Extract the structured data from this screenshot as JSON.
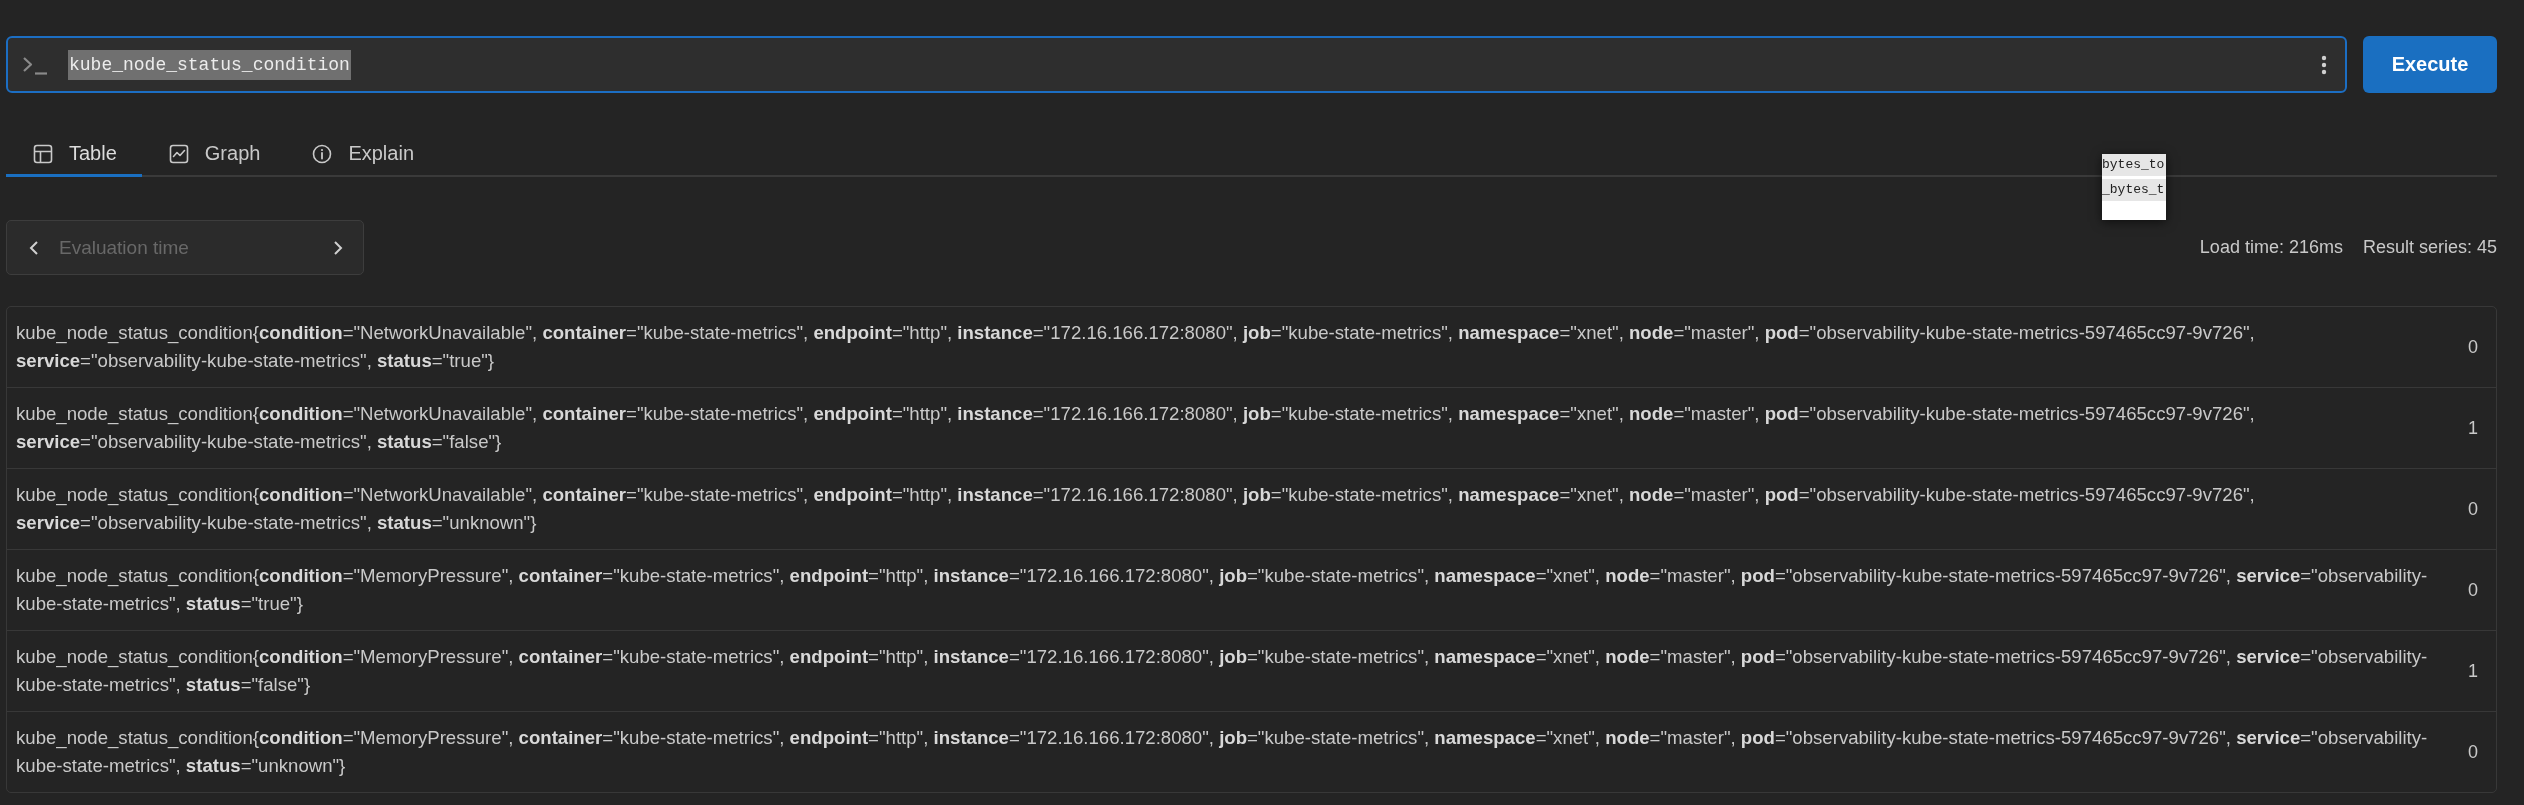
{
  "query": {
    "value": "kube_node_status_condition",
    "text_selected": true
  },
  "execute_button": {
    "label": "Execute"
  },
  "tabs": [
    {
      "label": "Table",
      "selected": true
    },
    {
      "label": "Graph",
      "selected": false
    },
    {
      "label": "Explain",
      "selected": false
    }
  ],
  "autocomplete_popup": {
    "items": [
      "bytes_to",
      "_bytes_t"
    ]
  },
  "evaluation_time": {
    "placeholder": "Evaluation time"
  },
  "stats": {
    "load_time": "Load time: 216ms",
    "result_series": "Result series: 45"
  },
  "results": [
    {
      "lines": [
        "kube_node_status_condition{**condition**=\"NetworkUnavailable\", **container**=\"kube-state-metrics\", **endpoint**=\"http\", **instance**=\"172.16.166.172:8080\", **job**=\"kube-state-metrics\", **namespace**=\"xnet\", **node**=\"master\", **pod**=\"observability-kube-state-metrics-597465cc97-9v726\",",
        "**service**=\"observability-kube-state-metrics\", **status**=\"true\"}"
      ],
      "value": "0"
    },
    {
      "lines": [
        "kube_node_status_condition{**condition**=\"NetworkUnavailable\", **container**=\"kube-state-metrics\", **endpoint**=\"http\", **instance**=\"172.16.166.172:8080\", **job**=\"kube-state-metrics\", **namespace**=\"xnet\", **node**=\"master\", **pod**=\"observability-kube-state-metrics-597465cc97-9v726\",",
        "**service**=\"observability-kube-state-metrics\", **status**=\"false\"}"
      ],
      "value": "1"
    },
    {
      "lines": [
        "kube_node_status_condition{**condition**=\"NetworkUnavailable\", **container**=\"kube-state-metrics\", **endpoint**=\"http\", **instance**=\"172.16.166.172:8080\", **job**=\"kube-state-metrics\", **namespace**=\"xnet\", **node**=\"master\", **pod**=\"observability-kube-state-metrics-597465cc97-9v726\",",
        "**service**=\"observability-kube-state-metrics\", **status**=\"unknown\"}"
      ],
      "value": "0"
    },
    {
      "lines": [
        "kube_node_status_condition{**condition**=\"MemoryPressure\", **container**=\"kube-state-metrics\", **endpoint**=\"http\", **instance**=\"172.16.166.172:8080\", **job**=\"kube-state-metrics\", **namespace**=\"xnet\", **node**=\"master\", **pod**=\"observability-kube-state-metrics-597465cc97-9v726\", **service**=\"observability-",
        "kube-state-metrics\", **status**=\"true\"}"
      ],
      "value": "0"
    },
    {
      "lines": [
        "kube_node_status_condition{**condition**=\"MemoryPressure\", **container**=\"kube-state-metrics\", **endpoint**=\"http\", **instance**=\"172.16.166.172:8080\", **job**=\"kube-state-metrics\", **namespace**=\"xnet\", **node**=\"master\", **pod**=\"observability-kube-state-metrics-597465cc97-9v726\", **service**=\"observability-",
        "kube-state-metrics\", **status**=\"false\"}"
      ],
      "value": "1"
    },
    {
      "lines": [
        "kube_node_status_condition{**condition**=\"MemoryPressure\", **container**=\"kube-state-metrics\", **endpoint**=\"http\", **instance**=\"172.16.166.172:8080\", **job**=\"kube-state-metrics\", **namespace**=\"xnet\", **node**=\"master\", **pod**=\"observability-kube-state-metrics-597465cc97-9v726\", **service**=\"observability-",
        "kube-state-metrics\", **status**=\"unknown\"}"
      ],
      "value": "0"
    }
  ]
}
